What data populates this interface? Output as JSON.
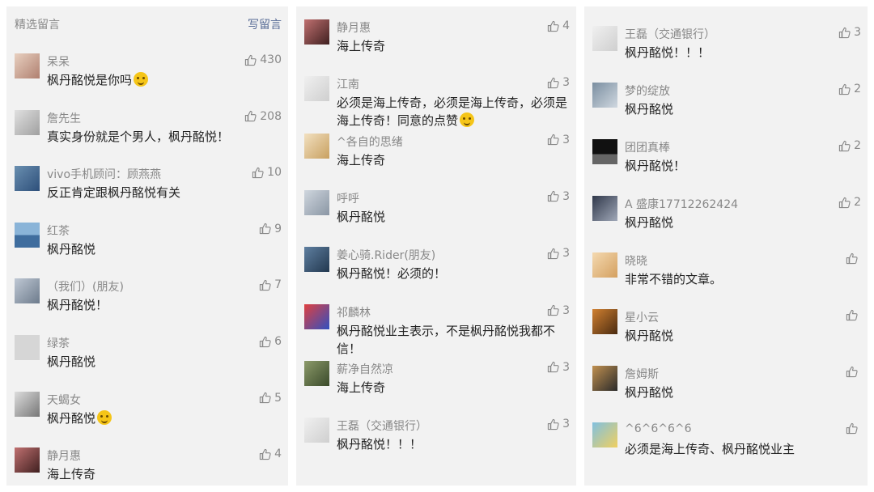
{
  "header": {
    "title": "精选留言",
    "write": "写留言"
  },
  "icons": {
    "like": "thumbs-up-icon",
    "emoji": "smile-emoji-icon"
  },
  "colors": {
    "link": "#576b95",
    "meta": "#888888",
    "text": "#222222",
    "panel": "#f2f2f2"
  },
  "col1": [
    {
      "name": "呆呆",
      "text": "枫丹酩悦是你吗",
      "likes": "430",
      "emoji": true
    },
    {
      "name": "詹先生",
      "text": "真实身份就是个男人，枫丹酩悦！",
      "likes": "208"
    },
    {
      "name": "vivo手机顾问：顾燕燕",
      "text": "反正肯定跟枫丹酩悦有关",
      "likes": "10"
    },
    {
      "name": "红茶",
      "text": "枫丹酩悦",
      "likes": "9"
    },
    {
      "name": "（我们）(朋友)",
      "text": "枫丹酩悦！",
      "likes": "7"
    },
    {
      "name": "绿茶",
      "text": "枫丹酩悦",
      "likes": "6"
    },
    {
      "name": "天蝎女",
      "text": "枫丹酩悦",
      "likes": "5",
      "emoji": true
    },
    {
      "name": "静月惠",
      "text": "海上传奇",
      "likes": "4"
    }
  ],
  "col2": [
    {
      "name": "静月惠",
      "text": "海上传奇",
      "likes": "4"
    },
    {
      "name": "江南",
      "text": "必须是海上传奇，必须是海上传奇，必须是海上传奇！同意的点赞",
      "likes": "3",
      "emoji": true
    },
    {
      "name": "^各自的思绪",
      "text": "海上传奇",
      "likes": "3"
    },
    {
      "name": "呼呼",
      "text": "枫丹酩悦",
      "likes": "3"
    },
    {
      "name": "姜心骑.Rider(朋友)",
      "text": "枫丹酩悦！必须的！",
      "likes": "3"
    },
    {
      "name": "祁麟林",
      "text": "枫丹酩悦业主表示，不是枫丹酩悦我都不信！",
      "likes": "3"
    },
    {
      "name": "薪净自然凉",
      "text": "海上传奇",
      "likes": "3"
    },
    {
      "name": "王磊（交通银行）",
      "text": "枫丹酩悦！！！",
      "likes": "3"
    }
  ],
  "col3": [
    {
      "name": "王磊（交通银行）",
      "text": "枫丹酩悦！！！",
      "likes": "3"
    },
    {
      "name": "梦的绽放",
      "text": "枫丹酩悦",
      "likes": "2"
    },
    {
      "name": "团团真棒",
      "text": "枫丹酩悦！",
      "likes": "2"
    },
    {
      "name": "A 盛康17712262424",
      "text": "枫丹酩悦",
      "likes": "2"
    },
    {
      "name": "晓晓",
      "text": "非常不错的文章。",
      "likes": ""
    },
    {
      "name": "星小云",
      "text": "枫丹酩悦",
      "likes": ""
    },
    {
      "name": "詹姆斯",
      "text": "枫丹酩悦",
      "likes": ""
    },
    {
      "name": "^6^6^6^6",
      "text": "必须是海上传奇、枫丹酩悦业主",
      "likes": ""
    }
  ]
}
